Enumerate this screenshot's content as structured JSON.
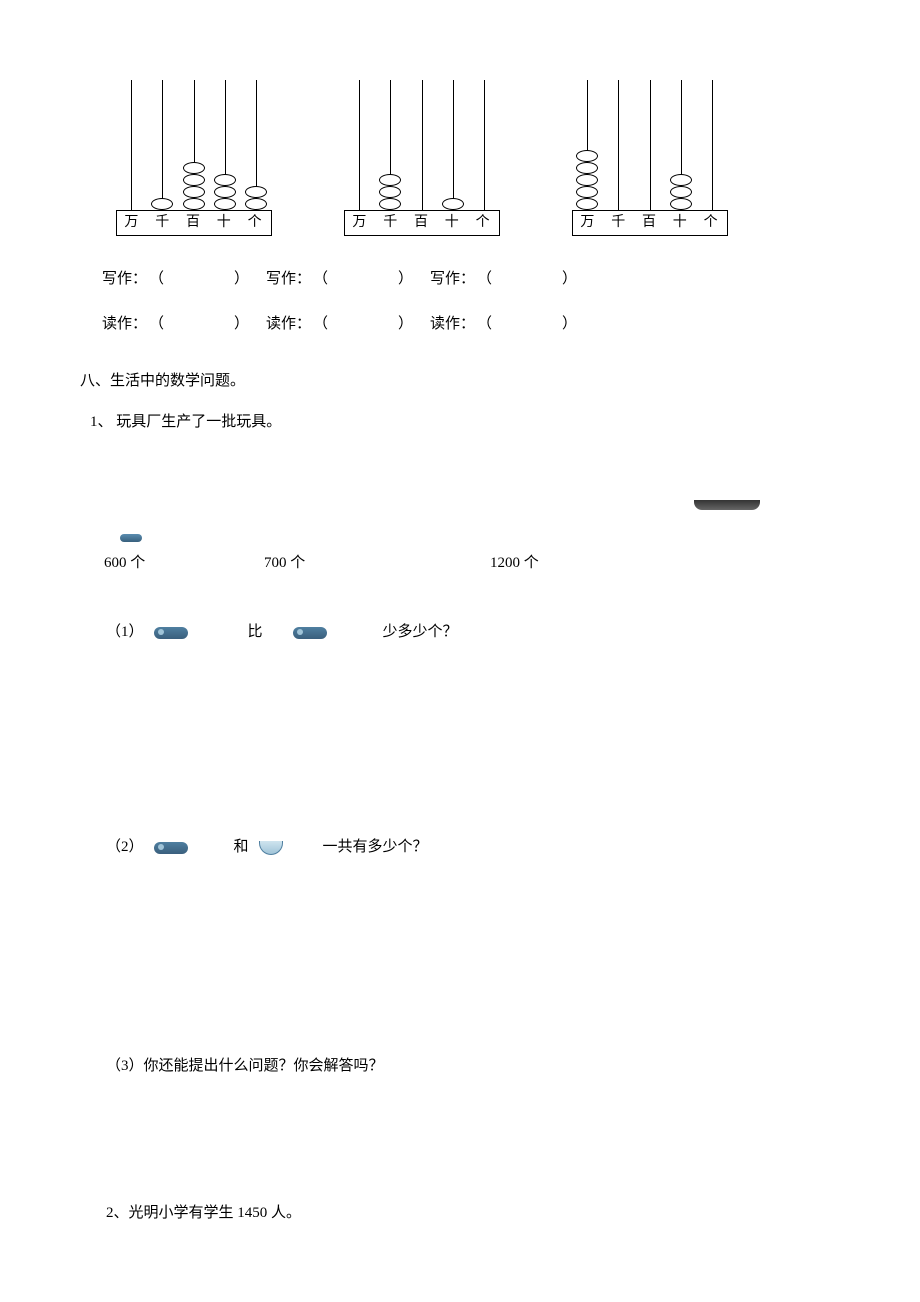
{
  "abacus_labels": [
    "万",
    "千",
    "百",
    "十",
    "个"
  ],
  "abacus": [
    {
      "beads": [
        0,
        1,
        4,
        3,
        2
      ]
    },
    {
      "beads": [
        0,
        3,
        0,
        1,
        0
      ]
    },
    {
      "beads": [
        5,
        0,
        0,
        3,
        0
      ]
    }
  ],
  "fill": {
    "write_label": "写作：",
    "read_label": "读作：",
    "open": "（",
    "close": "）"
  },
  "section8": "八、生活中的数学问题。",
  "q1": {
    "title": "1、 玩具厂生产了一批玩具。",
    "counts": {
      "a": "600 个",
      "b": "700 个",
      "c": "1200 个"
    },
    "sub1": {
      "num": "（1）",
      "mid": "比",
      "tail": "少多少个？"
    },
    "sub2": {
      "num": "（2）",
      "mid": "和",
      "tail": "一共有多少个？"
    },
    "sub3": "（3）你还能提出什么问题？你会解答吗？"
  },
  "q2": "2、光明小学有学生 1450 人。"
}
